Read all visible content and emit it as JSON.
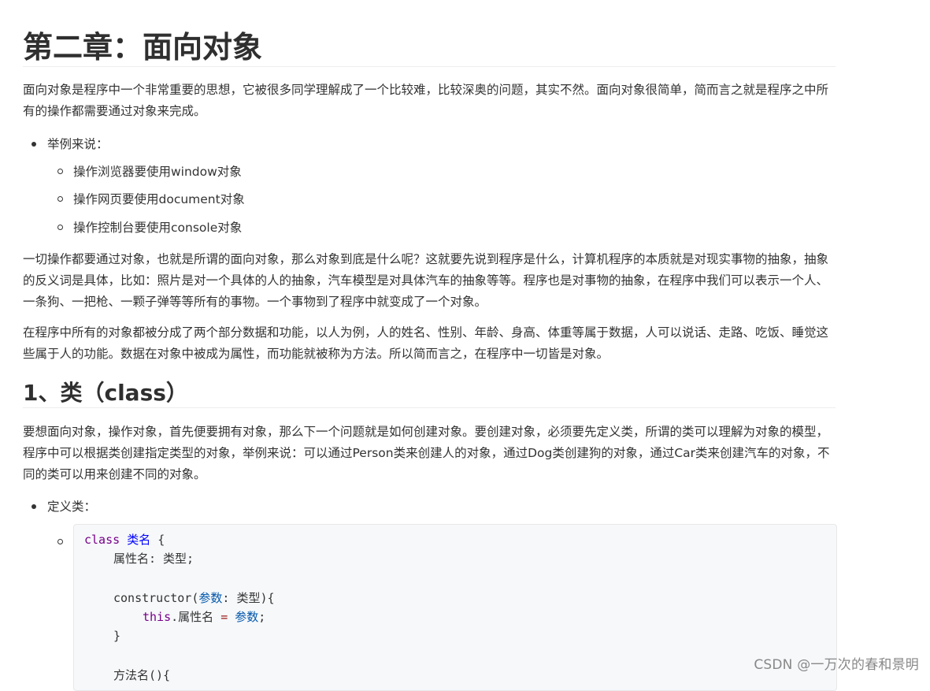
{
  "heading": "第二章：面向对象",
  "intro": "面向对象是程序中一个非常重要的思想，它被很多同学理解成了一个比较难，比较深奥的问题，其实不然。面向对象很简单，简而言之就是程序之中所有的操作都需要通过对象来完成。",
  "examples": {
    "label": "举例来说：",
    "items": [
      "操作浏览器要使用window对象",
      "操作网页要使用document对象",
      "操作控制台要使用console对象"
    ]
  },
  "para2": "一切操作都要通过对象，也就是所谓的面向对象，那么对象到底是什么呢？这就要先说到程序是什么，计算机程序的本质就是对现实事物的抽象，抽象的反义词是具体，比如：照片是对一个具体的人的抽象，汽车模型是对具体汽车的抽象等等。程序也是对事物的抽象，在程序中我们可以表示一个人、一条狗、一把枪、一颗子弹等等所有的事物。一个事物到了程序中就变成了一个对象。",
  "para3": "在程序中所有的对象都被分成了两个部分数据和功能，以人为例，人的姓名、性别、年龄、身高、体重等属于数据，人可以说话、走路、吃饭、睡觉这些属于人的功能。数据在对象中被成为属性，而功能就被称为方法。所以简而言之，在程序中一切皆是对象。",
  "section1": {
    "heading": "1、类（class）",
    "para": "要想面向对象，操作对象，首先便要拥有对象，那么下一个问题就是如何创建对象。要创建对象，必须要先定义类，所谓的类可以理解为对象的模型，程序中可以根据类创建指定类型的对象，举例来说：可以通过Person类来创建人的对象，通过Dog类创建狗的对象，通过Car类来创建汽车的对象，不同的类可以用来创建不同的对象。",
    "define_label": "定义类：",
    "code": {
      "l1_kw": "class",
      "l1_name": "类名",
      "l1_brace": " {",
      "l2": "属性名: 类型;",
      "l4_fn": "constructor(",
      "l4_param": "参数",
      "l4_rest": ": 类型){",
      "l5_this": "this",
      "l5_prop": ".属性名 ",
      "l5_eq": "=",
      "l5_val": "参数",
      "l5_end": ";",
      "l6": "}",
      "l8": "方法名(){"
    }
  },
  "watermark": "CSDN @一万次的春和景明"
}
